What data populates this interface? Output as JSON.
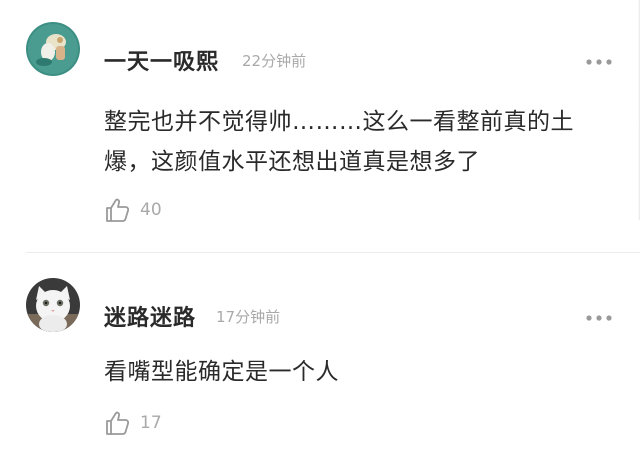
{
  "comments": [
    {
      "username": "一天一吸熙",
      "time": "22分钟前",
      "text": "整完也并不觉得帅………这么一看整前真的土爆，这颜值水平还想出道真是想多了",
      "likes": "40",
      "avatar_icon": "teal-avatar-with-cartoon-figure",
      "more_icon": "more-dots-icon",
      "like_icon": "thumbs-up-icon"
    },
    {
      "username": "迷路迷路",
      "time": "17分钟前",
      "text": "看嘴型能确定是一个人",
      "likes": "17",
      "avatar_icon": "white-cat-avatar",
      "more_icon": "more-dots-icon",
      "like_icon": "thumbs-up-icon"
    }
  ],
  "colors": {
    "username": "#2a2a2a",
    "secondary": "#a9a9a9",
    "avatar1_bg": "#3d8f84",
    "divider": "#ececec"
  }
}
